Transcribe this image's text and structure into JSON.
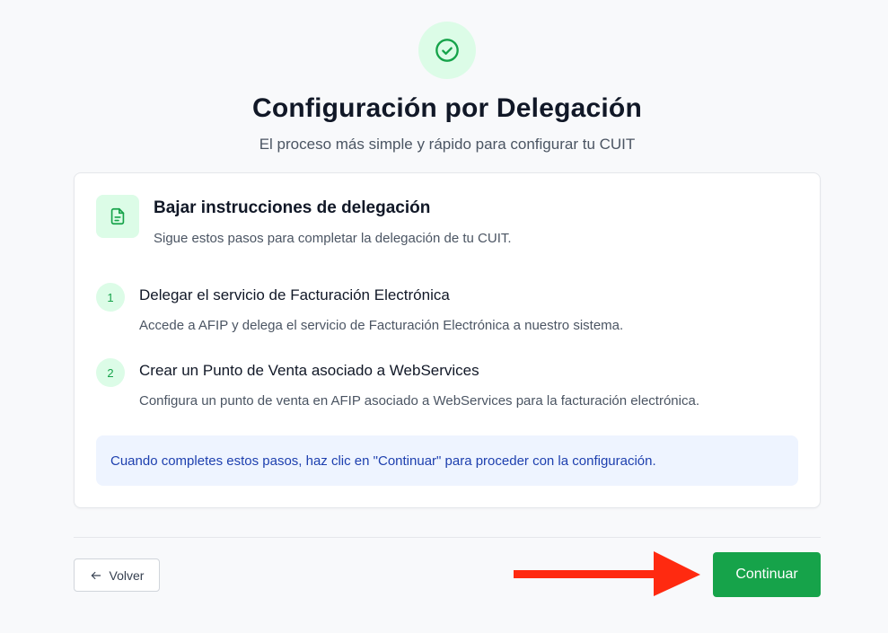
{
  "header": {
    "title": "Configuración por Delegación",
    "subtitle": "El proceso más simple y rápido para configurar tu CUIT",
    "icon": "check-circle-icon"
  },
  "card": {
    "icon": "document-icon",
    "title": "Bajar instrucciones de delegación",
    "description": "Sigue estos pasos para completar la delegación de tu CUIT.",
    "steps": [
      {
        "number": "1",
        "title": "Delegar el servicio de Facturación Electrónica",
        "description": "Accede a AFIP y delega el servicio de Facturación Electrónica a nuestro sistema."
      },
      {
        "number": "2",
        "title": "Crear un Punto de Venta asociado a WebServices",
        "description": "Configura un punto de venta en AFIP asociado a WebServices para la facturación electrónica."
      }
    ],
    "note": "Cuando completes estos pasos, haz clic en \"Continuar\" para proceder con la configuración."
  },
  "footer": {
    "back_label": "Volver",
    "continue_label": "Continuar"
  },
  "colors": {
    "accent": "#16a34a",
    "accent_light": "#dcfce7",
    "note_bg": "#eef4ff",
    "note_text": "#1e40af",
    "annotation_arrow": "#ff2a10"
  }
}
